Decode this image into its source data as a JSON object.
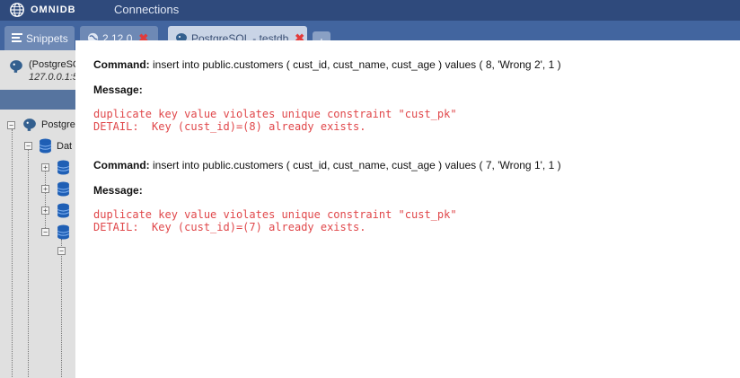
{
  "header": {
    "logo_text": "OMNIDB",
    "nav_connections": "Connections"
  },
  "tabs": [
    {
      "label": "Snippets",
      "icon": "snippets-icon"
    },
    {
      "label": "2.12.0",
      "icon": "globe-icon"
    },
    {
      "label": "PostgreSQL - testdb",
      "icon": "postgresql-elephant-icon"
    }
  ],
  "tab_close_symbol": "✖",
  "tab_add_symbol": "+",
  "left": {
    "connection_name": "(PostgreSQL",
    "connection_host": "127.0.0.1:5",
    "tree": [
      {
        "label": "Postgre",
        "icon": "postgresql-elephant-icon"
      },
      {
        "label": "Dat",
        "icon": "database-icon"
      },
      {
        "label": "",
        "icon": "database-icon"
      },
      {
        "label": "",
        "icon": "database-icon"
      },
      {
        "label": "",
        "icon": "database-icon"
      },
      {
        "label": "",
        "icon": "database-icon"
      }
    ]
  },
  "results": [
    {
      "command_label": "Command:",
      "command": "insert into public.customers ( cust_id, cust_name, cust_age ) values ( 8, 'Wrong 2', 1 )",
      "message_label": "Message:",
      "error_line1": "duplicate key value violates unique constraint \"cust_pk\"",
      "error_line2": "DETAIL:  Key (cust_id)=(8) already exists."
    },
    {
      "command_label": "Command:",
      "command": "insert into public.customers ( cust_id, cust_name, cust_age ) values ( 7, 'Wrong 1', 1 )",
      "message_label": "Message:",
      "error_line1": "duplicate key value violates unique constraint \"cust_pk\"",
      "error_line2": "DETAIL:  Key (cust_id)=(7) already exists."
    }
  ],
  "colors": {
    "header": "#2f4a7c",
    "tab_bar": "#42659f",
    "error_text": "#e0474a",
    "close_x": "#e23b3b"
  }
}
